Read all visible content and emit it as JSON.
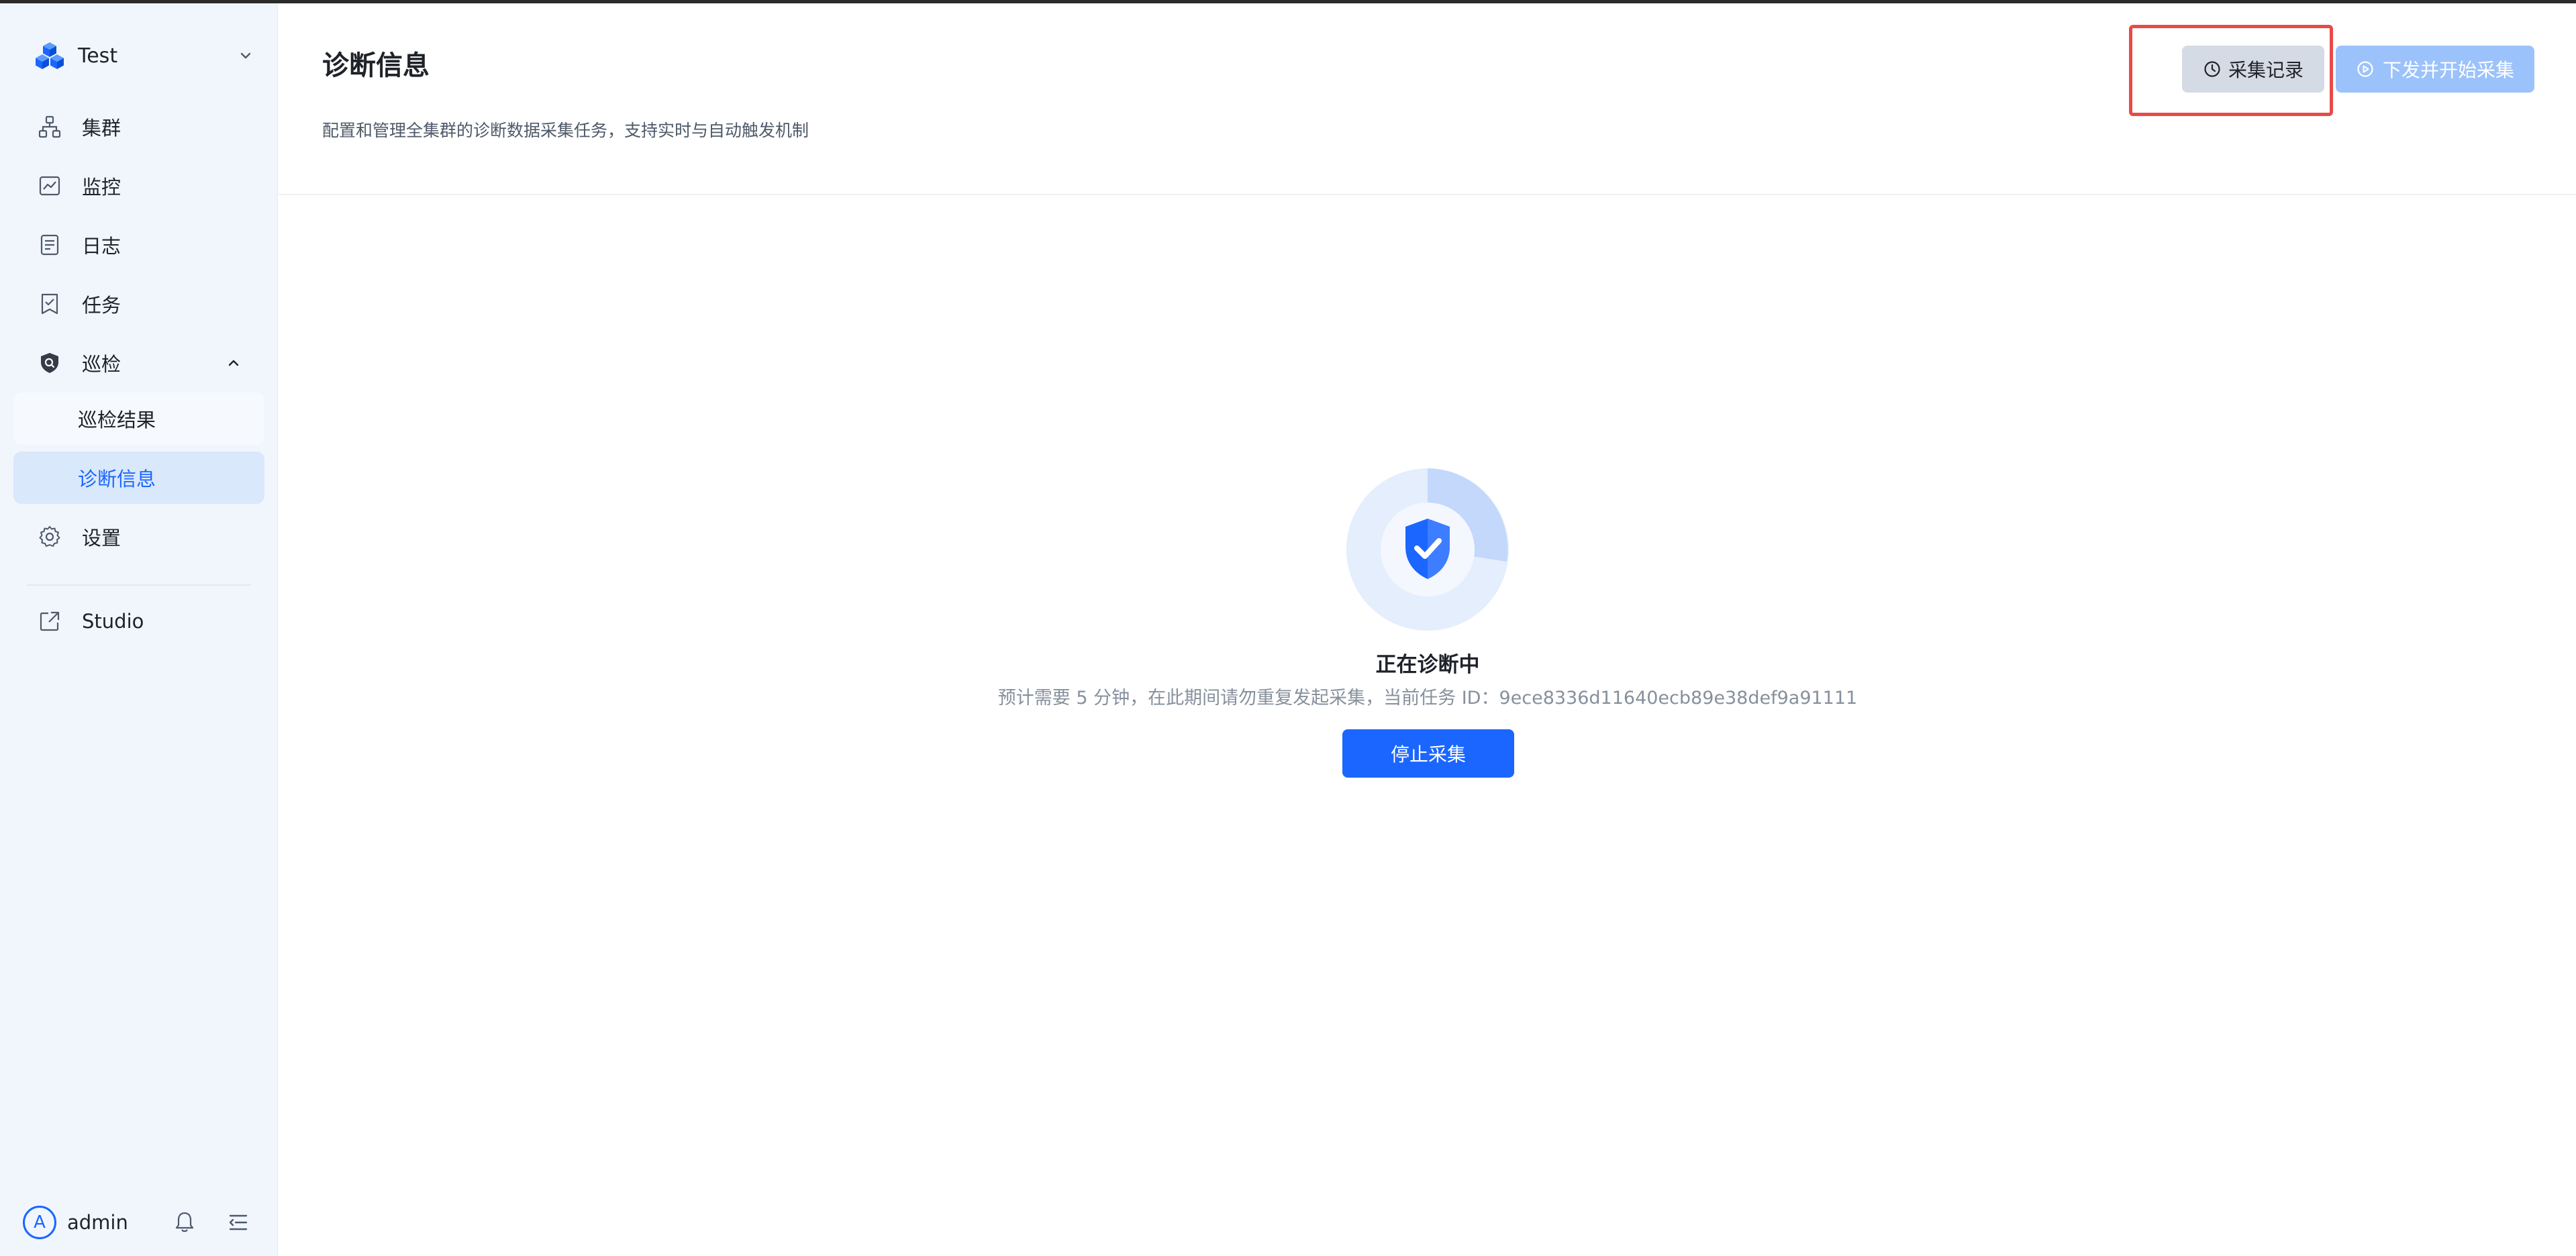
{
  "brand": {
    "name": "Test"
  },
  "nav": {
    "cluster": "集群",
    "monitor": "监控",
    "logs": "日志",
    "tasks": "任务",
    "inspection": "巡检",
    "inspection_results": "巡检结果",
    "diagnostics": "诊断信息",
    "settings": "设置",
    "studio": "Studio"
  },
  "user": {
    "avatar_letter": "A",
    "name": "admin"
  },
  "page": {
    "title": "诊断信息",
    "description": "配置和管理全集群的诊断数据采集任务，支持实时与自动触发机制"
  },
  "toolbar": {
    "records_label": "采集记录",
    "start_label": "下发并开始采集"
  },
  "status": {
    "title": "正在诊断中",
    "description": "预计需要 5 分钟，在此期间请勿重复发起采集，当前任务 ID：9ece8336d11640ecb89e38def9a91111",
    "stop_label": "停止采集"
  },
  "colors": {
    "accent": "#1a66ff",
    "sidebar_bg": "#f1f6fd",
    "active_item_bg": "#d9e8fb",
    "highlight": "#e84a45",
    "disabled_primary": "#9cc2fb"
  }
}
